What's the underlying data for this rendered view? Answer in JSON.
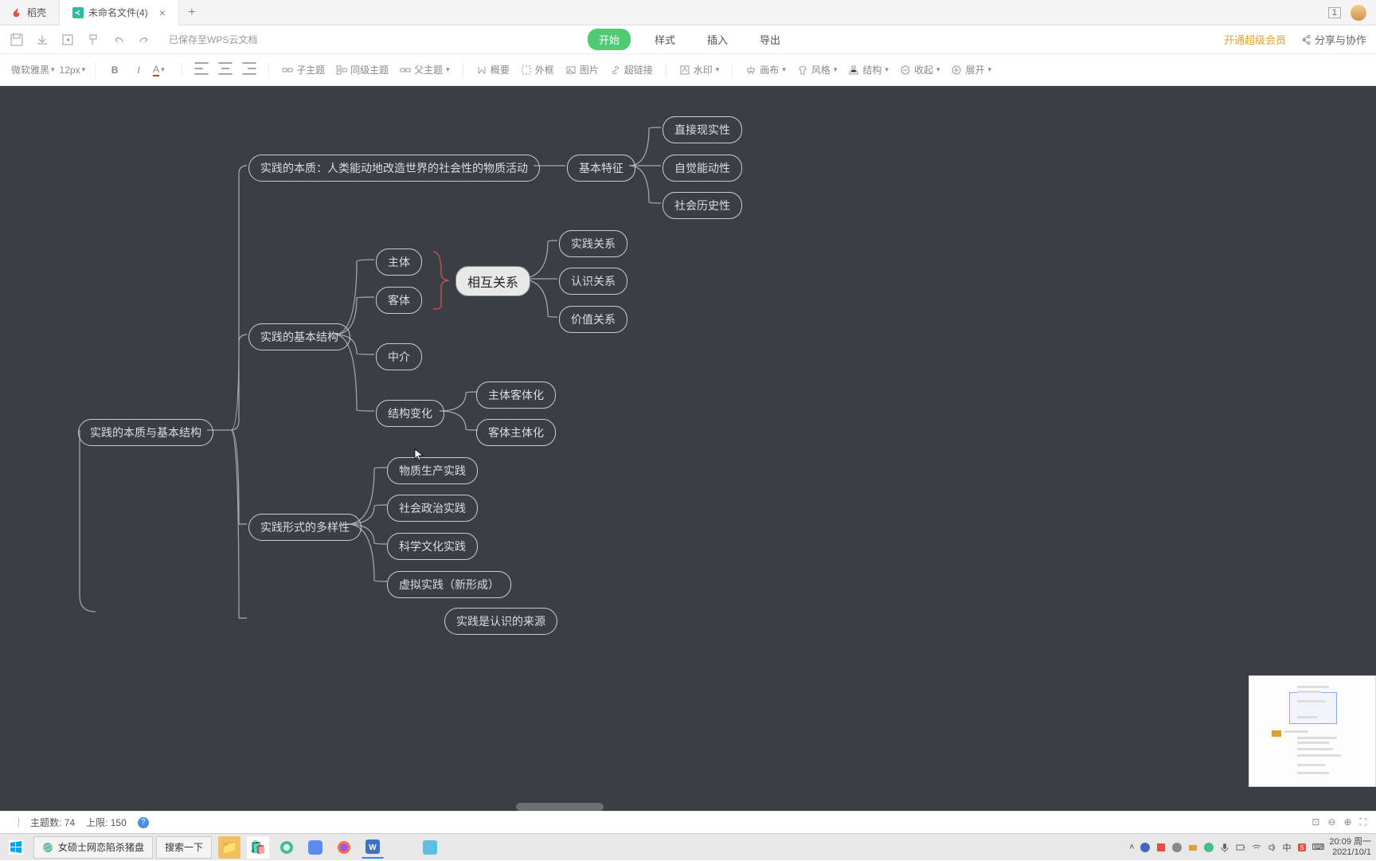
{
  "tabs": {
    "first": "稻壳",
    "active": "未命名文件(4)",
    "badge": "1"
  },
  "toolbar1": {
    "save_status": "已保存至WPS云文档",
    "menu": {
      "start": "开始",
      "style": "样式",
      "insert": "插入",
      "export": "导出"
    },
    "vip": "开通超级会员",
    "share": "分享与协作"
  },
  "toolbar2": {
    "font": "微软雅黑",
    "size": "12px",
    "subtopic": "子主题",
    "sibling": "同级主题",
    "parent": "父主题",
    "summary": "概要",
    "boundary": "外框",
    "image": "图片",
    "hyperlink": "超链接",
    "watermark": "水印",
    "canvas": "画布",
    "skin": "风格",
    "structure": "结构",
    "collapse": "收起",
    "expand": "展开"
  },
  "mindmap": {
    "root": "实践的本质与基本结构",
    "b1": {
      "title": "实践的本质：人类能动地改造世界的社会性的物质活动",
      "feat": "基本特征",
      "c": [
        "直接现实性",
        "自觉能动性",
        "社会历史性"
      ]
    },
    "b2": {
      "title": "实践的基本结构",
      "c": [
        "主体",
        "客体",
        "中介",
        "结构变化"
      ],
      "rel": "相互关系",
      "relc": [
        "实践关系",
        "认识关系",
        "价值关系"
      ],
      "sc": [
        "主体客体化",
        "客体主体化"
      ]
    },
    "b3": {
      "title": "实践形式的多样性",
      "c": [
        "物质生产实践",
        "社会政治实践",
        "科学文化实践",
        "虚拟实践（新形成）"
      ]
    },
    "b4": {
      "title": "实践是认识的来源"
    }
  },
  "status": {
    "topics_label": "主题数:",
    "topics": "74",
    "limit_label": "上限:",
    "limit": "150"
  },
  "taskbar": {
    "window": "女硕士网恋陷杀猪盘",
    "search": "搜索一下",
    "time": "20:09 周一",
    "date": "2021/10/1",
    "ime": "中"
  }
}
